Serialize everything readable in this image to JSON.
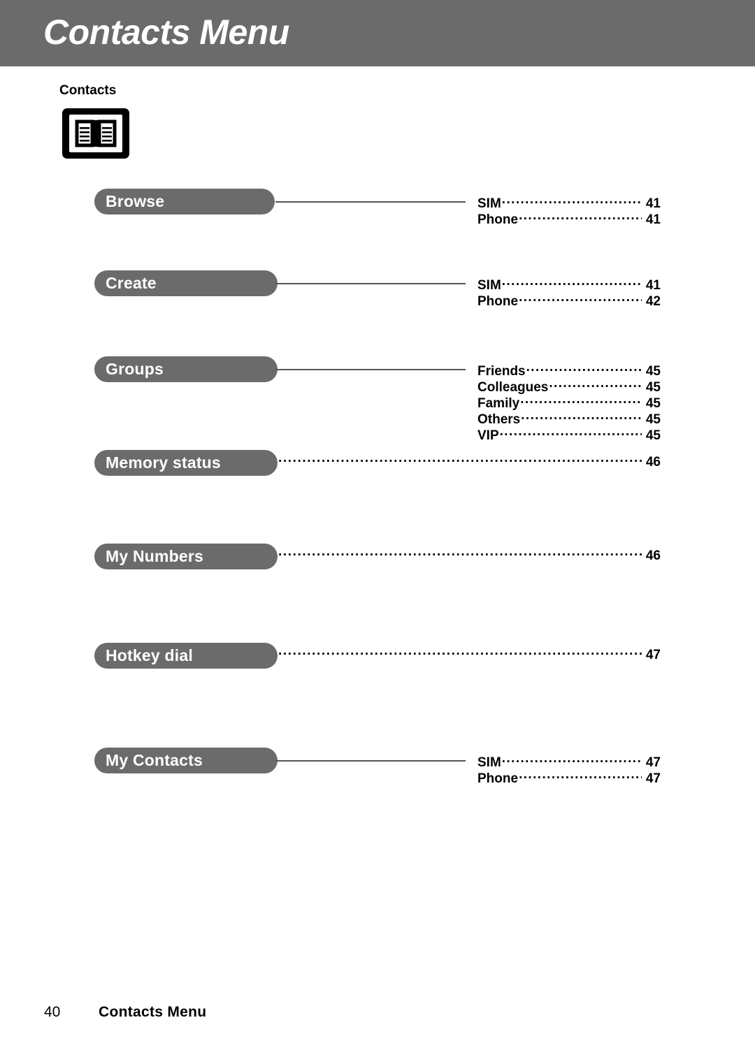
{
  "header": {
    "title": "Contacts Menu",
    "bg_color": "#6b6b6b",
    "text_color": "#ffffff"
  },
  "section": {
    "label": "Contacts",
    "icon": "address-book-icon"
  },
  "menu": {
    "pill_color": "#6b6b6b",
    "items": [
      {
        "label": "Browse",
        "connector": "solid",
        "children": [
          {
            "label": "SIM",
            "page": "41"
          },
          {
            "label": "Phone",
            "page": "41"
          }
        ]
      },
      {
        "label": "Create",
        "connector": "solid",
        "children": [
          {
            "label": "SIM",
            "page": "41"
          },
          {
            "label": "Phone",
            "page": "42"
          }
        ]
      },
      {
        "label": "Groups",
        "connector": "solid",
        "children": [
          {
            "label": "Friends",
            "page": "45"
          },
          {
            "label": "Colleagues",
            "page": "45"
          },
          {
            "label": "Family",
            "page": "45"
          },
          {
            "label": "Others",
            "page": "45"
          },
          {
            "label": "VIP",
            "page": "45"
          }
        ]
      },
      {
        "label": "Memory status",
        "connector": "dotted",
        "page": "46",
        "children": []
      },
      {
        "label": "My Numbers",
        "connector": "dotted",
        "page": "46",
        "children": []
      },
      {
        "label": "Hotkey dial",
        "connector": "dotted",
        "page": "47",
        "children": []
      },
      {
        "label": "My Contacts",
        "connector": "solid",
        "children": [
          {
            "label": "SIM",
            "page": "47"
          },
          {
            "label": "Phone",
            "page": "47"
          }
        ]
      }
    ]
  },
  "footer": {
    "page_number": "40",
    "title": "Contacts Menu"
  }
}
